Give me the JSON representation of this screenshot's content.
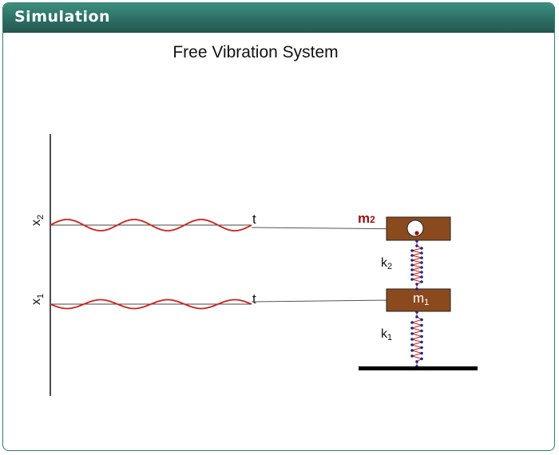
{
  "panel": {
    "title": "Simulation"
  },
  "simulation": {
    "title": "Free Vibration System",
    "graph_labels": {
      "x2": {
        "base": "x",
        "sub": "2"
      },
      "x1": {
        "base": "x",
        "sub": "1"
      },
      "t_upper": "t",
      "t_lower": "t"
    },
    "masses": {
      "m2": {
        "base": "m",
        "sub": "2"
      },
      "m1": {
        "base": "m",
        "sub": "1"
      }
    },
    "springs": {
      "k2": {
        "base": "k",
        "sub": "2"
      },
      "k1": {
        "base": "k",
        "sub": "1"
      }
    },
    "colors": {
      "header": "#2c6c62",
      "wave": "#d0201a",
      "mass": "#8b4a1e",
      "spring": "#d0201a",
      "spring_nodes": "#1a2a8a",
      "m2_label": "#9b1010",
      "ground": "#000000"
    }
  }
}
